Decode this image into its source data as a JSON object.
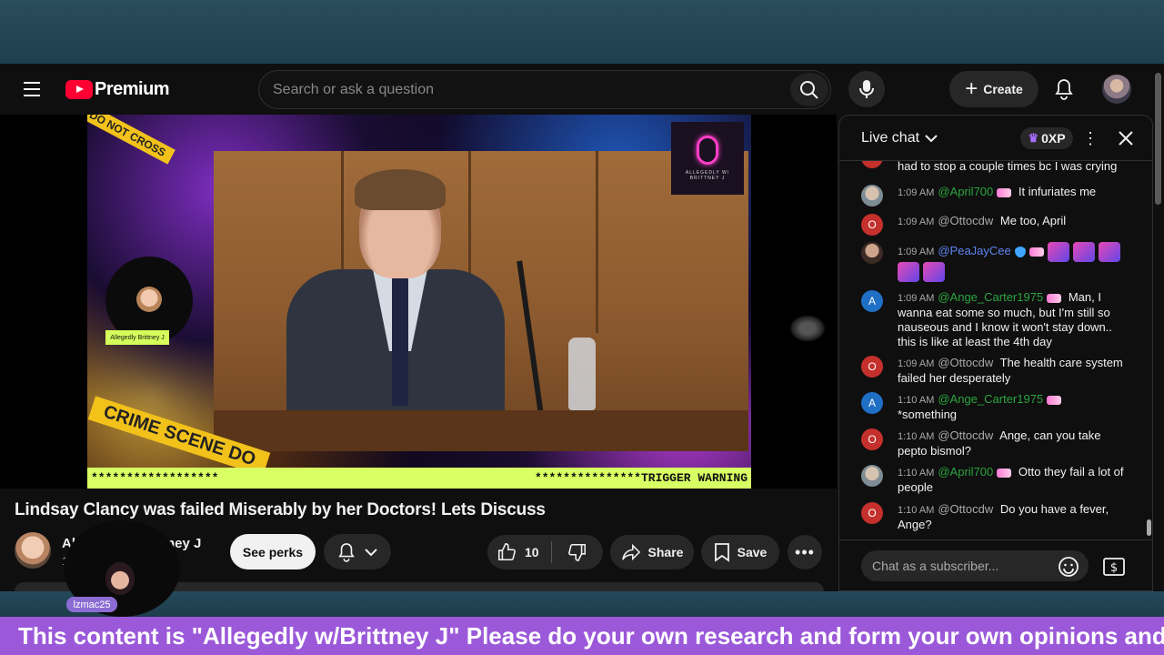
{
  "masthead": {
    "logo_text": "Premium",
    "search_placeholder": "Search or ask a question",
    "create_label": "Create"
  },
  "video": {
    "overlay_logo_text": "ALLEGEDLY W/ BRITTNEY J",
    "host_tag": "Allegedly Brittney J",
    "tape_top": "DO NOT CROSS",
    "tape_bottom": "CRIME SCENE DO",
    "warning_left": "******************",
    "warning_right": "***************TRIGGER WARNING"
  },
  "title": "Lindsay Clancy was failed Miserably by her Doctors! Lets Discuss",
  "channel": {
    "name": "Allegedly w/Brittney J",
    "name_visible_left": "Al",
    "name_visible_right": "tney J",
    "subs_visible": "1",
    "see_perks": "See perks"
  },
  "actions": {
    "like_count": "10",
    "share": "Share",
    "save": "Save"
  },
  "overlay_user": "lzmac25",
  "chat": {
    "title": "Live chat",
    "xp": "0XP",
    "input_placeholder": "Chat as a subscriber...",
    "messages": [
      {
        "time": "",
        "author": "",
        "text": "had to stop a couple times bc I was crying",
        "avatar": "",
        "color": "#c4302b"
      },
      {
        "time": "1:09 AM",
        "author": "@April700",
        "text": "It infuriates me",
        "avatar": "",
        "color": "#8a9aa8"
      },
      {
        "time": "1:09 AM",
        "author": "@Ottocdw",
        "text": "Me too, April",
        "avatar": "O",
        "color": "#c4302b"
      },
      {
        "time": "1:09 AM",
        "author": "@PeaJayCee",
        "text": "",
        "avatar": "",
        "color": "#6b4a3c"
      },
      {
        "time": "1:09 AM",
        "author": "@Ange_Carter1975",
        "text": "Man, I wanna eat some so much, but I'm still so nauseous and I know it won't stay down.. this is like at least the 4th day",
        "avatar": "A",
        "color": "#1f6fc5"
      },
      {
        "time": "1:09 AM",
        "author": "@Ottocdw",
        "text": "The health care system failed her desperately",
        "avatar": "O",
        "color": "#c4302b"
      },
      {
        "time": "1:10 AM",
        "author": "@Ange_Carter1975",
        "text": "*something",
        "avatar": "A",
        "color": "#1f6fc5"
      },
      {
        "time": "1:10 AM",
        "author": "@Ottocdw",
        "text": "Ange, can you take pepto bismol?",
        "avatar": "O",
        "color": "#c4302b"
      },
      {
        "time": "1:10 AM",
        "author": "@April700",
        "text": "Otto they fail a lot of people",
        "avatar": "",
        "color": "#8a9aa8"
      },
      {
        "time": "1:10 AM",
        "author": "@Ottocdw",
        "text": "Do you have a fever, Ange?",
        "avatar": "O",
        "color": "#c4302b"
      }
    ]
  },
  "ticker": "This content is \"Allegedly w/Brittney J\" Please do your own research and form your own opinions and thank"
}
